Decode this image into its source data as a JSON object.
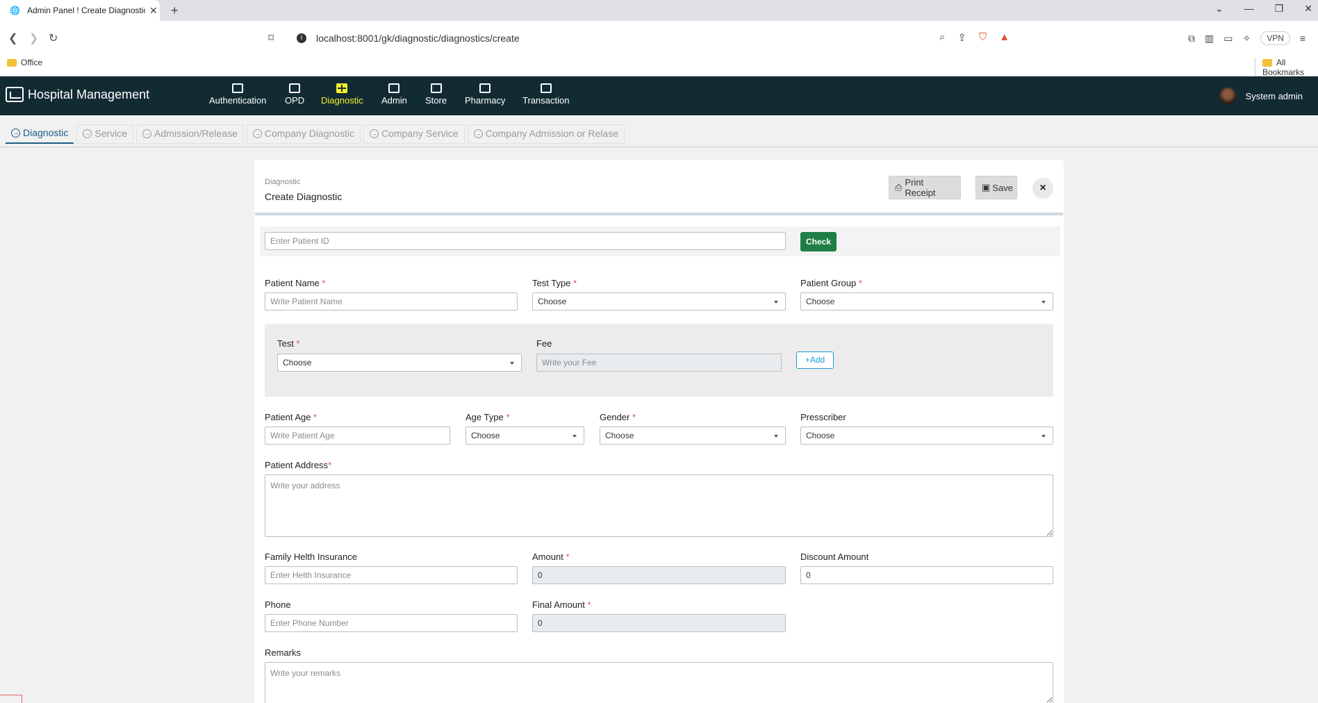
{
  "browser": {
    "tab_title": "Admin Panel ! Create Diagnostic",
    "url": "localhost:8001/gk/diagnostic/diagnostics/create",
    "vpn_label": "VPN",
    "bookmarks": {
      "office": "Office",
      "all": "All Bookmarks"
    }
  },
  "header": {
    "brand": "Hospital Management",
    "nav": [
      "Authentication",
      "OPD",
      "Diagnostic",
      "Admin",
      "Store",
      "Pharmacy",
      "Transaction"
    ],
    "active_nav": "Diagnostic",
    "user": "System admin"
  },
  "subtabs": [
    "Diagnostic",
    "Service",
    "Admission/Release",
    "Company Diagnostic",
    "Company Service",
    "Company Admission or Relase"
  ],
  "card": {
    "breadcrumb": "Diagnostic",
    "title": "Create Diagnostic",
    "print_label": "Print Receipt",
    "save_label": "Save",
    "close_symbol": "×"
  },
  "form": {
    "patient_id_placeholder": "Enter Patient ID",
    "check_label": "Check",
    "patient_name": {
      "label": "Patient Name",
      "placeholder": "Write Patient Name"
    },
    "test_type": {
      "label": "Test Type",
      "value": "Choose"
    },
    "patient_group": {
      "label": "Patient Group",
      "value": "Choose"
    },
    "test": {
      "label": "Test",
      "value": "Choose"
    },
    "fee": {
      "label": "Fee",
      "placeholder": "Write your Fee"
    },
    "add_label": "Add",
    "patient_age": {
      "label": "Patient Age",
      "placeholder": "Write Patient Age"
    },
    "age_type": {
      "label": "Age Type",
      "value": "Choose"
    },
    "gender": {
      "label": "Gender",
      "value": "Choose"
    },
    "prescriber": {
      "label": "Presscriber",
      "value": "Choose"
    },
    "address": {
      "label": "Patient Address",
      "placeholder": "Write your address"
    },
    "insurance": {
      "label": "Family Helth Insurance",
      "placeholder": "Enter Helth Insurance"
    },
    "amount": {
      "label": "Amount",
      "value": "0"
    },
    "discount": {
      "label": "Discount Amount",
      "value": "0"
    },
    "phone": {
      "label": "Phone",
      "placeholder": "Enter Phone Number"
    },
    "final_amount": {
      "label": "Final Amount",
      "value": "0"
    },
    "remarks": {
      "label": "Remarks",
      "placeholder": "Write your remarks"
    },
    "required_mark": "*"
  },
  "colors": {
    "header_bg": "#122b33",
    "active_nav": "#f4f02a",
    "check_btn": "#1e7e45",
    "add_btn": "#1a9bd7",
    "required": "#d9534f"
  }
}
